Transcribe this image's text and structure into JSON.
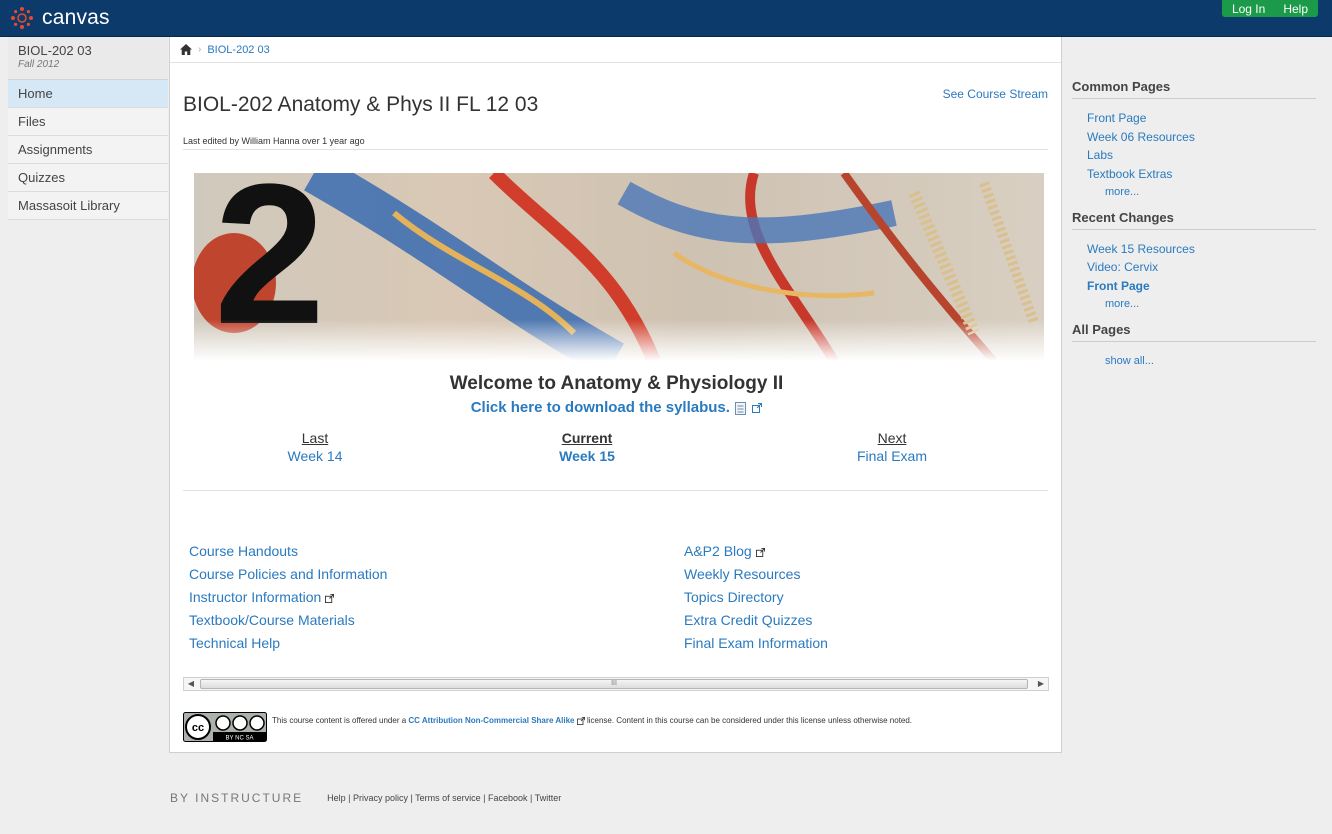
{
  "header": {
    "logo_text": "canvas",
    "login_label": "Log In",
    "help_label": "Help",
    "brand_color": "#0c3a6b",
    "action_color": "#1b9b4a"
  },
  "sidebar": {
    "course_code": "BIOL-202 03",
    "course_term": "Fall 2012",
    "items": [
      {
        "label": "Home",
        "active": true
      },
      {
        "label": "Files"
      },
      {
        "label": "Assignments"
      },
      {
        "label": "Quizzes"
      },
      {
        "label": "Massasoit Library"
      }
    ]
  },
  "breadcrumb": {
    "home_icon": "home-icon",
    "course": "BIOL-202 03"
  },
  "page": {
    "title": "BIOL-202 Anatomy & Phys II FL 12 03",
    "see_stream": "See Course Stream",
    "last_edited": "Last edited by William Hanna over 1 year ago",
    "welcome": "Welcome to Anatomy & Physiology II",
    "syllabus": "Click here to download the syllabus.",
    "weeks": {
      "last_label": "Last",
      "last_value": "Week 14",
      "current_label": "Current",
      "current_value": "Week 15",
      "next_label": "Next",
      "next_value": "Final Exam"
    },
    "links_left": [
      "Course Handouts",
      "Course Policies and Information",
      "Instructor Information",
      "Textbook/Course Materials",
      "Technical Help"
    ],
    "links_right": [
      "A&P2 Blog",
      "Weekly Resources",
      "Topics Directory",
      "Extra Credit Quizzes",
      "Final Exam Information"
    ],
    "scroll_grip": "III",
    "license": {
      "prefix": "This course content is offered under a",
      "link": "CC Attribution Non-Commercial Share Alike",
      "suffix": "license. Content in this course can be considered under this license unless otherwise noted.",
      "badge_text": "BY NC SA"
    }
  },
  "rightbar": {
    "common_pages_title": "Common Pages",
    "common_pages": [
      "Front Page",
      "Week 06 Resources",
      "Labs",
      "Textbook Extras"
    ],
    "common_more": "more...",
    "recent_changes_title": "Recent Changes",
    "recent_changes": [
      "Week 15 Resources",
      "Video: Cervix",
      "Front Page"
    ],
    "recent_more": "more...",
    "all_pages_title": "All Pages",
    "show_all": "show all..."
  },
  "footer": {
    "brand": "BY INSTRUCTURE",
    "links": "Help | Privacy policy | Terms of service | Facebook | Twitter"
  }
}
